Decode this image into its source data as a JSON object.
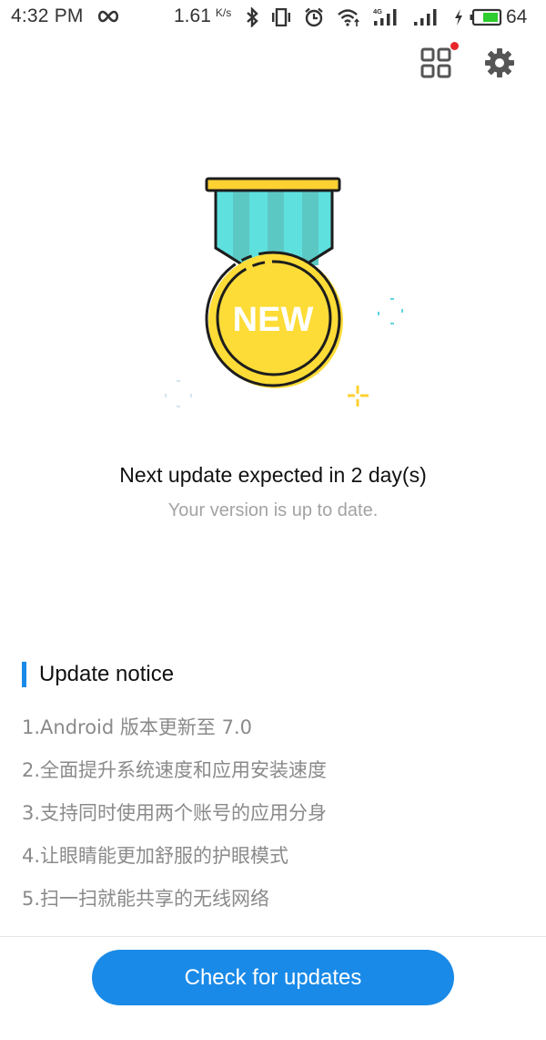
{
  "status_bar": {
    "time": "4:32 PM",
    "net_speed": "1.61",
    "net_unit": "K/s",
    "network_type": "4G",
    "battery_percent": "64",
    "icons": [
      "infinity-icon",
      "bluetooth-icon",
      "vibrate-icon",
      "alarm-icon",
      "wifi-icon",
      "signal-4g-icon",
      "signal-icon",
      "charging-icon",
      "battery-icon"
    ]
  },
  "top_actions": {
    "apps_icon": "grid-apps-icon",
    "apps_has_notification": true,
    "settings_icon": "gear-icon"
  },
  "hero": {
    "badge_text": "NEW",
    "next_update": "Next update expected in 2 day(s)",
    "status": "Your version is up to date."
  },
  "notice": {
    "title": "Update notice",
    "items": [
      "1.Android 版本更新至 7.0",
      "2.全面提升系统速度和应用安装速度",
      "3.支持同时使用两个账号的应用分身",
      "4.让眼睛能更加舒服的护眼模式",
      "5.扫一扫就能共享的无线网络"
    ]
  },
  "actions": {
    "check_label": "Check for updates"
  },
  "colors": {
    "accent": "#1a8ae8",
    "notification_dot": "#e8262a",
    "medal_gold": "#fddc37",
    "ribbon_teal": "#5ee0de",
    "battery_green": "#2ecc2e"
  }
}
